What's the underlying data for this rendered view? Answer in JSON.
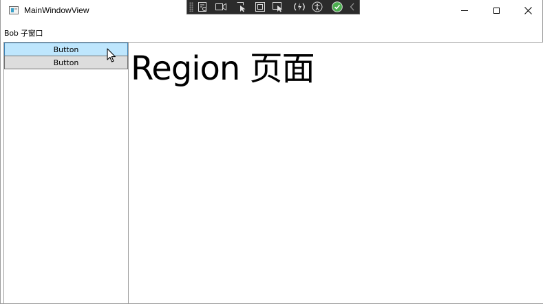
{
  "window": {
    "title": "MainWindowView"
  },
  "caption_buttons": {
    "minimize_icon": "minimize-icon",
    "maximize_icon": "maximize-icon",
    "close_icon": "close-icon"
  },
  "devtools_toolbar": {
    "icons": [
      "visual-tree-icon",
      "track-focus-icon",
      "select-element-icon",
      "display-layout-adorners-icon",
      "preview-selection-icon",
      "hot-reload-icon",
      "accessibility-icon",
      "status-check-icon",
      "collapse-toolbar-icon"
    ],
    "status_color": "#4caf50"
  },
  "menu": {
    "label": "Bob 子窗口"
  },
  "nav": {
    "buttons": [
      {
        "label": "Button",
        "state": "hover"
      },
      {
        "label": "Button",
        "state": "normal"
      }
    ]
  },
  "region": {
    "text": "Region 页面"
  },
  "colors": {
    "hover_button_bg": "#bee6fd",
    "hover_button_border": "#3c7fb1",
    "normal_button_bg": "#dddddd"
  }
}
